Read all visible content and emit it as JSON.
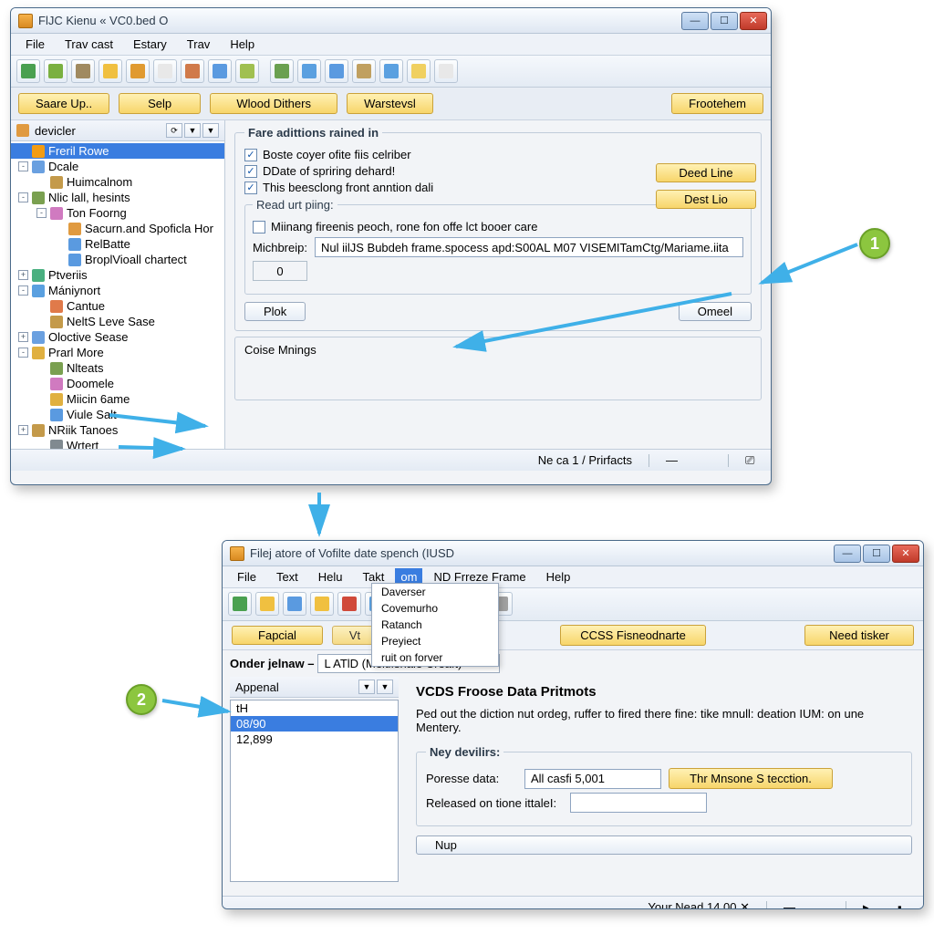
{
  "win1": {
    "title": "FlJC Kienu « VC0.bed O",
    "menubar": [
      "File",
      "Trav cast",
      "Estary",
      "Trav",
      "Help"
    ],
    "btnrow": [
      "Saare Up..",
      "Selp",
      "Wlood Dithers",
      "Warstevsl"
    ],
    "btn_right": "Frootehem",
    "side_head": "devicler",
    "tree": [
      {
        "l": 1,
        "exp": "",
        "ic": "#f39c12",
        "label": "Freril Rowe",
        "sel": true
      },
      {
        "l": 1,
        "exp": "-",
        "ic": "#6aa0e0",
        "label": "Dcale"
      },
      {
        "l": 2,
        "exp": "",
        "ic": "#c49a4a",
        "label": "Huimcalnom"
      },
      {
        "l": 1,
        "exp": "-",
        "ic": "#7aa050",
        "label": "Nlic lall, hesints"
      },
      {
        "l": 2,
        "exp": "-",
        "ic": "#d07ac0",
        "label": "Ton Foorng"
      },
      {
        "l": 3,
        "exp": "",
        "ic": "#e09a40",
        "label": "Sacurn.and Spoficla Hor"
      },
      {
        "l": 3,
        "exp": "",
        "ic": "#5a9ae0",
        "label": "RelBatte"
      },
      {
        "l": 3,
        "exp": "",
        "ic": "#5a9ae0",
        "label": "BroplVioall chartect"
      },
      {
        "l": 1,
        "exp": "+",
        "ic": "#4ab080",
        "label": "Ptveriis"
      },
      {
        "l": 1,
        "exp": "-",
        "ic": "#5aa0e0",
        "label": "Mániynort"
      },
      {
        "l": 2,
        "exp": "",
        "ic": "#e07a4a",
        "label": "Cantue"
      },
      {
        "l": 2,
        "exp": "",
        "ic": "#c49a4a",
        "label": "NeltS Leve Sase"
      },
      {
        "l": 1,
        "exp": "+",
        "ic": "#6aa0e0",
        "label": "Oloctive Sease"
      },
      {
        "l": 1,
        "exp": "-",
        "ic": "#e0b040",
        "label": "Prarl More"
      },
      {
        "l": 2,
        "exp": "",
        "ic": "#7aa050",
        "label": "Nlteats"
      },
      {
        "l": 2,
        "exp": "",
        "ic": "#d07ac0",
        "label": "Doomele"
      },
      {
        "l": 2,
        "exp": "",
        "ic": "#e0b040",
        "label": "Miicin 6ame"
      },
      {
        "l": 2,
        "exp": "",
        "ic": "#5a9ae0",
        "label": "Viule Salt"
      },
      {
        "l": 1,
        "exp": "+",
        "ic": "#c49a4a",
        "label": "NRiik Tanoes"
      },
      {
        "l": 2,
        "exp": "",
        "ic": "#808a90",
        "label": "Wrtert"
      }
    ],
    "fs_legend": "Fare adittions rained in",
    "chk1": "Boste coyer ofite fiis celriber",
    "chk2": "DDate of spriring dehard!",
    "chk3": "This beesclong front anntion dali",
    "sub_legend": "Read urt piing:",
    "chk4": "Miinang fireenis peoch, rone fon offe lct booer care",
    "field_label": "Michbreip:",
    "field_value": "Nul iilJS Bubdeh frame.spocess apd:S00AL M07 VISEMITamCtg/Mariame.iita",
    "num_value": "0",
    "plok": "Plok",
    "omeel": "Omeel",
    "deed": "Deed Line",
    "dest": "Dest Lio",
    "coise": "Coise Mnings",
    "status": "Ne ca 1 / Prirfacts"
  },
  "win2": {
    "title": "Filej atore of Vofilte date spench (IUSD",
    "menubar": [
      "File",
      "Text",
      "Helu",
      "Takt",
      "ND Frreze Frame",
      "Help"
    ],
    "menu_active": "om",
    "dropdown": [
      "Daverser",
      "Covemurho",
      "Ratanch",
      "Preyiect",
      "ruit on forver"
    ],
    "tabs": [
      "Fapcial",
      "Vt"
    ],
    "ccss": "CCSS Fisneodnarte",
    "need": "Need tisker",
    "onder_label": "Onder jelnaw –",
    "onder_value": "L ATlD (Meitifshale Creaft)",
    "appenal": "Appenal",
    "list": [
      "tH",
      "08/90",
      "12,899"
    ],
    "h2": "VCDS Froose Data Pritmots",
    "para": "Ped out the diction nut ordeg, ruffer to fired there fine:  tike mnull: deation IUM: on une Mentery.",
    "ney_legend": "Ney devilirs:",
    "poresse_label": "Poresse data:",
    "poresse_value": "All casfi 5,001",
    "thr_btn": "Thr Mnsone S tecction.",
    "released_label": "Released on tione ittaleI:",
    "nup": "Nup",
    "status": "Your Nead 14.00 ✕"
  },
  "badges": {
    "b1": "1",
    "b2": "2"
  },
  "icon_colors": [
    "#4aa050",
    "#7ab040",
    "#a08a60",
    "#f0c040",
    "#e09a30",
    "#e8e8e8",
    "#d07a4a",
    "#5a9ae0",
    "#a0c050",
    "#6aa050",
    "#5aa0e0",
    "#5a9ae0",
    "#c0a060",
    "#5aa0e0",
    "#f0d060",
    "#e8e8e8"
  ]
}
